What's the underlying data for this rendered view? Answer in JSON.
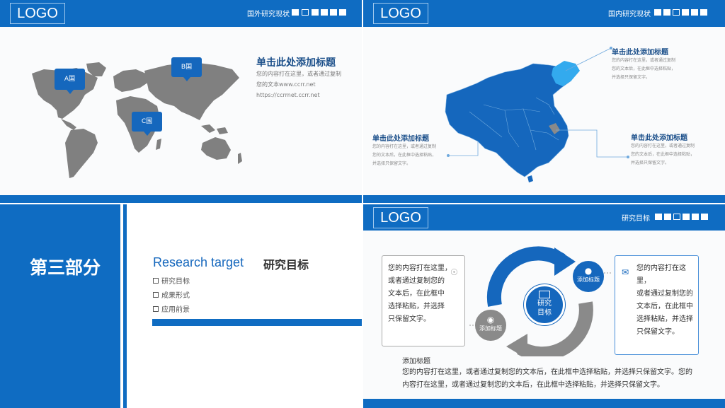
{
  "slide1": {
    "logo": "LOGO",
    "header_title": "国外研究现状",
    "markers": [
      "A国",
      "B国",
      "C国"
    ],
    "title": "单击此处添加标题",
    "lines": [
      "您的内容打在这里，或者通过复制",
      "您的文本www.ccrr.net",
      "https://ccrrnet.ccrr.net"
    ]
  },
  "slide2": {
    "logo": "LOGO",
    "header_title": "国内研究现状",
    "callouts": [
      {
        "title": "单击此处添加标题",
        "lines": [
          "您的内容打在这里，或者通过复制",
          "您的文本后，在此框中选择粘贴，",
          "并选择只保留文字。"
        ]
      },
      {
        "title": "单击此处添加标题",
        "lines": [
          "您的内容打在这里，或者通过复制",
          "您的文本后，在此框中选择粘贴，",
          "并选择只保留文字。"
        ]
      },
      {
        "title": "单击此处添加标题",
        "lines": [
          "您的内容打在这里，或者通过复制",
          "您的文本后，在此框中选择粘贴，",
          "并选择只保留文字。"
        ]
      }
    ]
  },
  "slide3": {
    "section": "第三部分",
    "en_title": "Research target",
    "cn_title": "研究目标",
    "items": [
      "研究目标",
      "成果形式",
      "应用前景"
    ]
  },
  "slide4": {
    "logo": "LOGO",
    "header_title": "研究目标",
    "left_box": [
      "您的内容打在这里，",
      "或者通过复制您的",
      "文本后，在此框中",
      "选择粘贴，并选择",
      "只保留文字。"
    ],
    "right_box": [
      "您的内容打在这里，",
      "或者通过复制您的",
      "文本后，在此框中",
      "选择粘贴，并选择",
      "只保留文字。"
    ],
    "center_label_1": "研究",
    "center_label_2": "目标",
    "bubble_blue": "添加标题",
    "bubble_grey": "添加标题",
    "bottom_title": "添加标题",
    "bottom_text_1": "您的内容打在这里，或者通过复制您的文本后，在此框中选择粘贴，并选择只保留文字。您的",
    "bottom_text_2": "内容打在这里，或者通过复制您的文本后，在此框中选择粘贴，并选择只保留文字。"
  },
  "colors": {
    "brand": "#0f6cc2",
    "dark_title": "#1b4f8a",
    "grey_map": "#808080",
    "highlight": "#33aaee"
  },
  "icons": [
    "medal-icon",
    "chat-icon",
    "mail-icon",
    "laptop-icon",
    "piggy-bank-icon"
  ]
}
